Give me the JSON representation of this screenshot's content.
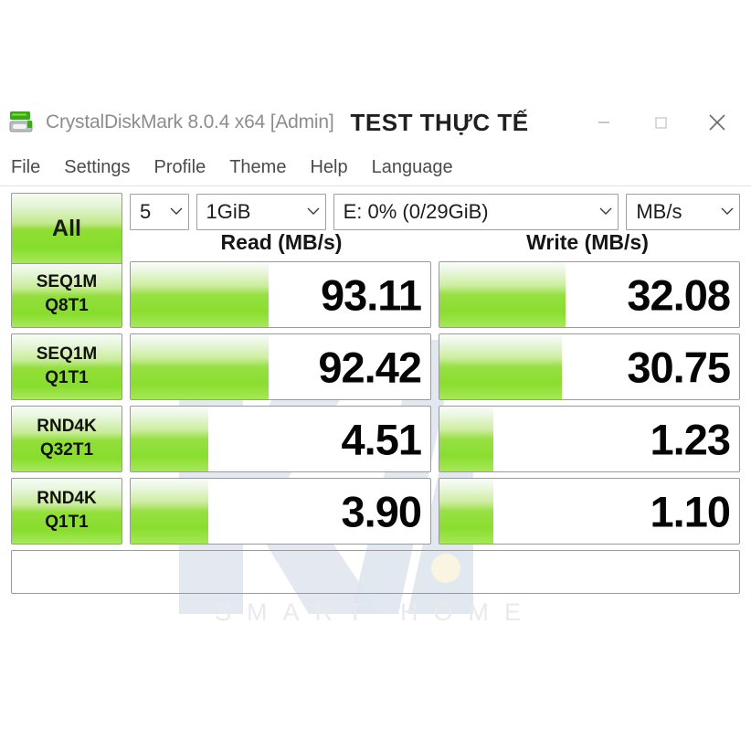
{
  "window": {
    "app_title": "CrystalDiskMark 8.0.4 x64 [Admin]",
    "overlay_title": "TEST THỰC TẾ",
    "icon": "crystaldiskmark-app-icon",
    "controls": {
      "minimize": "minimize-icon",
      "maximize": "maximize-icon",
      "close": "close-icon"
    }
  },
  "menu": {
    "items": [
      {
        "label": "File"
      },
      {
        "label": "Settings"
      },
      {
        "label": "Profile"
      },
      {
        "label": "Theme"
      },
      {
        "label": "Help"
      },
      {
        "label": "Language"
      }
    ]
  },
  "toolbar": {
    "all_button_label": "All",
    "test_count": "5",
    "test_size": "1GiB",
    "drive": "E: 0% (0/29GiB)",
    "unit": "MB/s",
    "chevron_icon": "chevron-down-icon"
  },
  "columns": {
    "read_header": "Read (MB/s)",
    "write_header": "Write (MB/s)"
  },
  "colors": {
    "accent_green": "#8ade2f",
    "bar_green_light": "#eaf7e0",
    "border_gray": "#9a9a9a",
    "value_text": "#050505",
    "watermark": "#dfe5ee"
  },
  "results": {
    "rows": [
      {
        "test": "SEQ1M",
        "queue": "Q8T1",
        "read": "93.11",
        "write": "32.08",
        "read_fill_pct": 46,
        "write_fill_pct": 42
      },
      {
        "test": "SEQ1M",
        "queue": "Q1T1",
        "read": "92.42",
        "write": "30.75",
        "read_fill_pct": 46,
        "write_fill_pct": 41
      },
      {
        "test": "RND4K",
        "queue": "Q32T1",
        "read": "4.51",
        "write": "1.23",
        "read_fill_pct": 26,
        "write_fill_pct": 18
      },
      {
        "test": "RND4K",
        "queue": "Q1T1",
        "read": "3.90",
        "write": "1.10",
        "read_fill_pct": 26,
        "write_fill_pct": 18
      }
    ]
  },
  "status_bar": {
    "text": ""
  },
  "watermark": {
    "text": "SMART HOME",
    "logo": "ka-logo-watermark"
  }
}
